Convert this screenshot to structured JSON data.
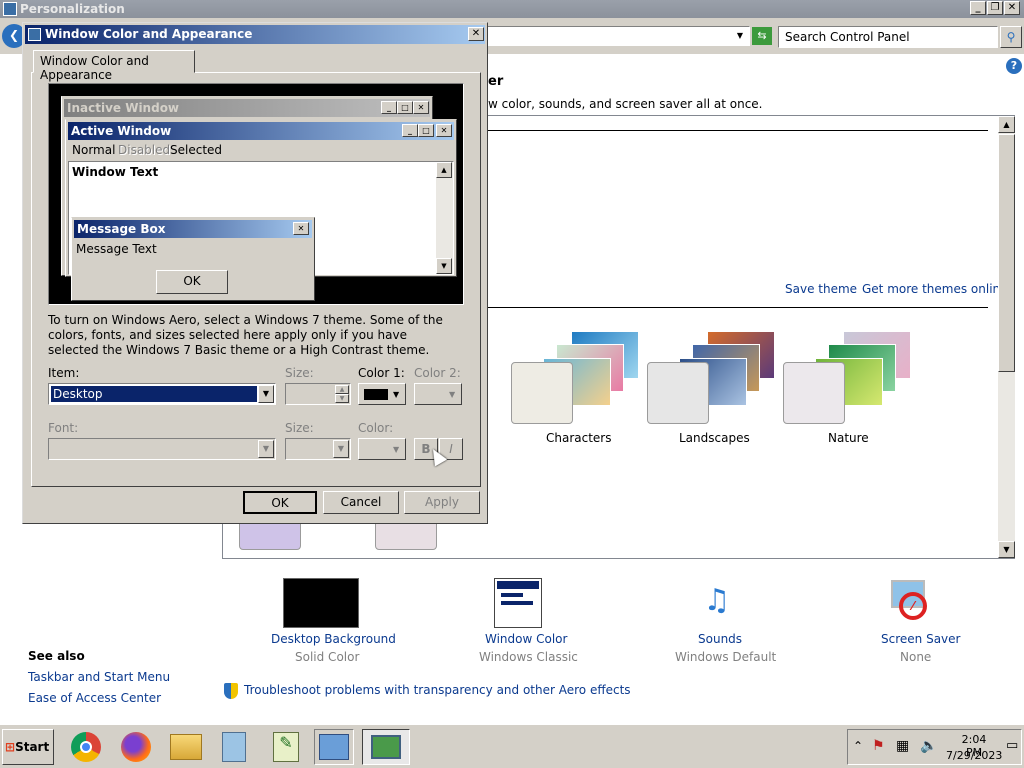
{
  "main_window": {
    "title": "Personalization",
    "search_placeholder": "Search Control Panel",
    "heading_suffix": "er",
    "subtitle_fragment": "w color, sounds, and screen saver all at once.",
    "save_theme": "Save theme",
    "get_more_themes": "Get more themes online",
    "themes": [
      {
        "label": "Characters"
      },
      {
        "label": "Landscapes"
      },
      {
        "label": "Nature"
      }
    ],
    "bottom_items": [
      {
        "label": "Desktop Background",
        "sub": "Solid Color"
      },
      {
        "label": "Window Color",
        "sub": "Windows Classic"
      },
      {
        "label": "Sounds",
        "sub": "Windows Default"
      },
      {
        "label": "Screen Saver",
        "sub": "None"
      }
    ],
    "see_also": {
      "title": "See also",
      "links": [
        "Taskbar and Start Menu",
        "Ease of Access Center"
      ]
    },
    "troubleshoot": "Troubleshoot problems with transparency and other Aero effects"
  },
  "dialog": {
    "title": "Window Color and Appearance",
    "tab": "Window Color and Appearance",
    "preview": {
      "inactive_title": "Inactive Window",
      "active_title": "Active Window",
      "menu": [
        "Normal",
        "Disabled",
        "Selected"
      ],
      "window_text": "Window Text",
      "msgbox_title": "Message Box",
      "msgbox_text": "Message Text",
      "msgbox_ok": "OK"
    },
    "info": "To turn on Windows Aero, select a Windows 7 theme.  Some of the colors, fonts, and sizes selected here apply only if you have selected the Windows 7 Basic theme or a High Contrast theme.",
    "item_label": "Item:",
    "item_value": "Desktop",
    "size_label": "Size:",
    "color1_label": "Color 1:",
    "color2_label": "Color 2:",
    "font_label": "Font:",
    "size2_label": "Size:",
    "color_label": "Color:",
    "bold": "B",
    "italic": "I",
    "ok": "OK",
    "cancel": "Cancel",
    "apply": "Apply"
  },
  "taskbar": {
    "start": "Start",
    "time": "2:04 PM",
    "date": "7/29/2023"
  },
  "colors": {
    "active_title": "#0a246a",
    "inactive_title": "#808080",
    "desktop_color": "#000000",
    "link": "#0b3a8f"
  }
}
